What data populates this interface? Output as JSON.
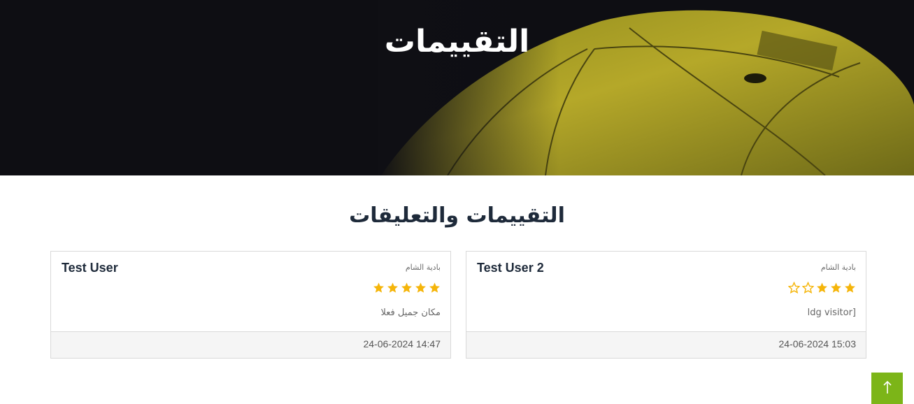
{
  "hero": {
    "title": "التقييمات"
  },
  "section": {
    "title": "التقييمات والتعليقات"
  },
  "reviews": [
    {
      "name": "Test User 2",
      "place": "بادية الشام",
      "rating": 3,
      "max_rating": 5,
      "comment": "ldg visitor]",
      "date": "24-06-2024 15:03"
    },
    {
      "name": "Test User",
      "place": "بادية الشام",
      "rating": 5,
      "max_rating": 5,
      "comment": "مكان جميل فعلا",
      "date": "24-06-2024 14:47"
    }
  ],
  "colors": {
    "star": "#f5b50a",
    "scroll_top_button": "#7cb518",
    "heading": "#1e2a3a"
  },
  "icons": {
    "scroll_top": "arrow-up-icon",
    "star": "star-icon"
  }
}
